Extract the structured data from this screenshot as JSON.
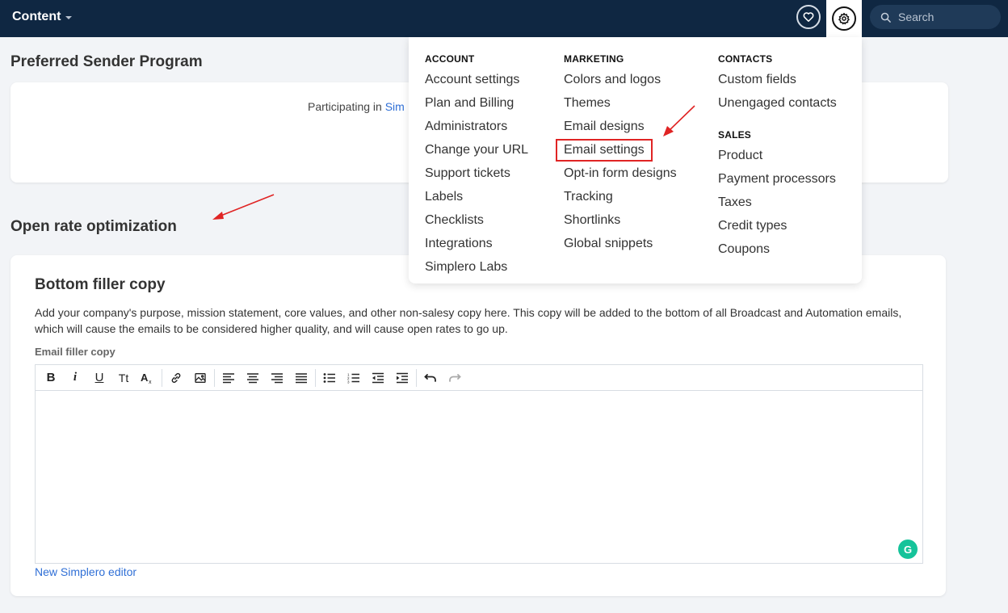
{
  "topbar": {
    "title": "Content",
    "search_placeholder": "Search"
  },
  "sections": {
    "preferred_title": "Preferred Sender Program",
    "participating_prefix": "Participating in",
    "participating_link": "Sim",
    "open_rate_title": "Open rate optimization"
  },
  "filler_card": {
    "heading": "Bottom filler copy",
    "description": "Add your company's purpose, mission statement, core values, and other non-salesy copy here. This copy will be added to the bottom of all Broadcast and Automation emails, which will cause the emails to be considered higher quality, and will cause open rates to go up.",
    "field_label": "Email filler copy",
    "editor_link": "New Simplero editor"
  },
  "toolbar": {
    "bold": "B",
    "italic": "i",
    "underline": "U",
    "text_size": "Tt"
  },
  "dropdown": {
    "account": {
      "heading": "ACCOUNT",
      "items": [
        "Account settings",
        "Plan and Billing",
        "Administrators",
        "Change your URL",
        "Support tickets",
        "Labels",
        "Checklists",
        "Integrations",
        "Simplero Labs"
      ]
    },
    "marketing": {
      "heading": "MARKETING",
      "items": [
        "Colors and logos",
        "Themes",
        "Email designs",
        "Email settings",
        "Opt-in form designs",
        "Tracking",
        "Shortlinks",
        "Global snippets"
      ]
    },
    "contacts": {
      "heading": "CONTACTS",
      "items": [
        "Custom fields",
        "Unengaged contacts"
      ]
    },
    "sales": {
      "heading": "SALES",
      "items": [
        "Product",
        "Payment processors",
        "Taxes",
        "Credit types",
        "Coupons"
      ]
    }
  },
  "colors": {
    "topbar": "#0f2742",
    "link": "#2f6fd6",
    "annotation": "#e02424",
    "grammarly": "#15c39a"
  }
}
